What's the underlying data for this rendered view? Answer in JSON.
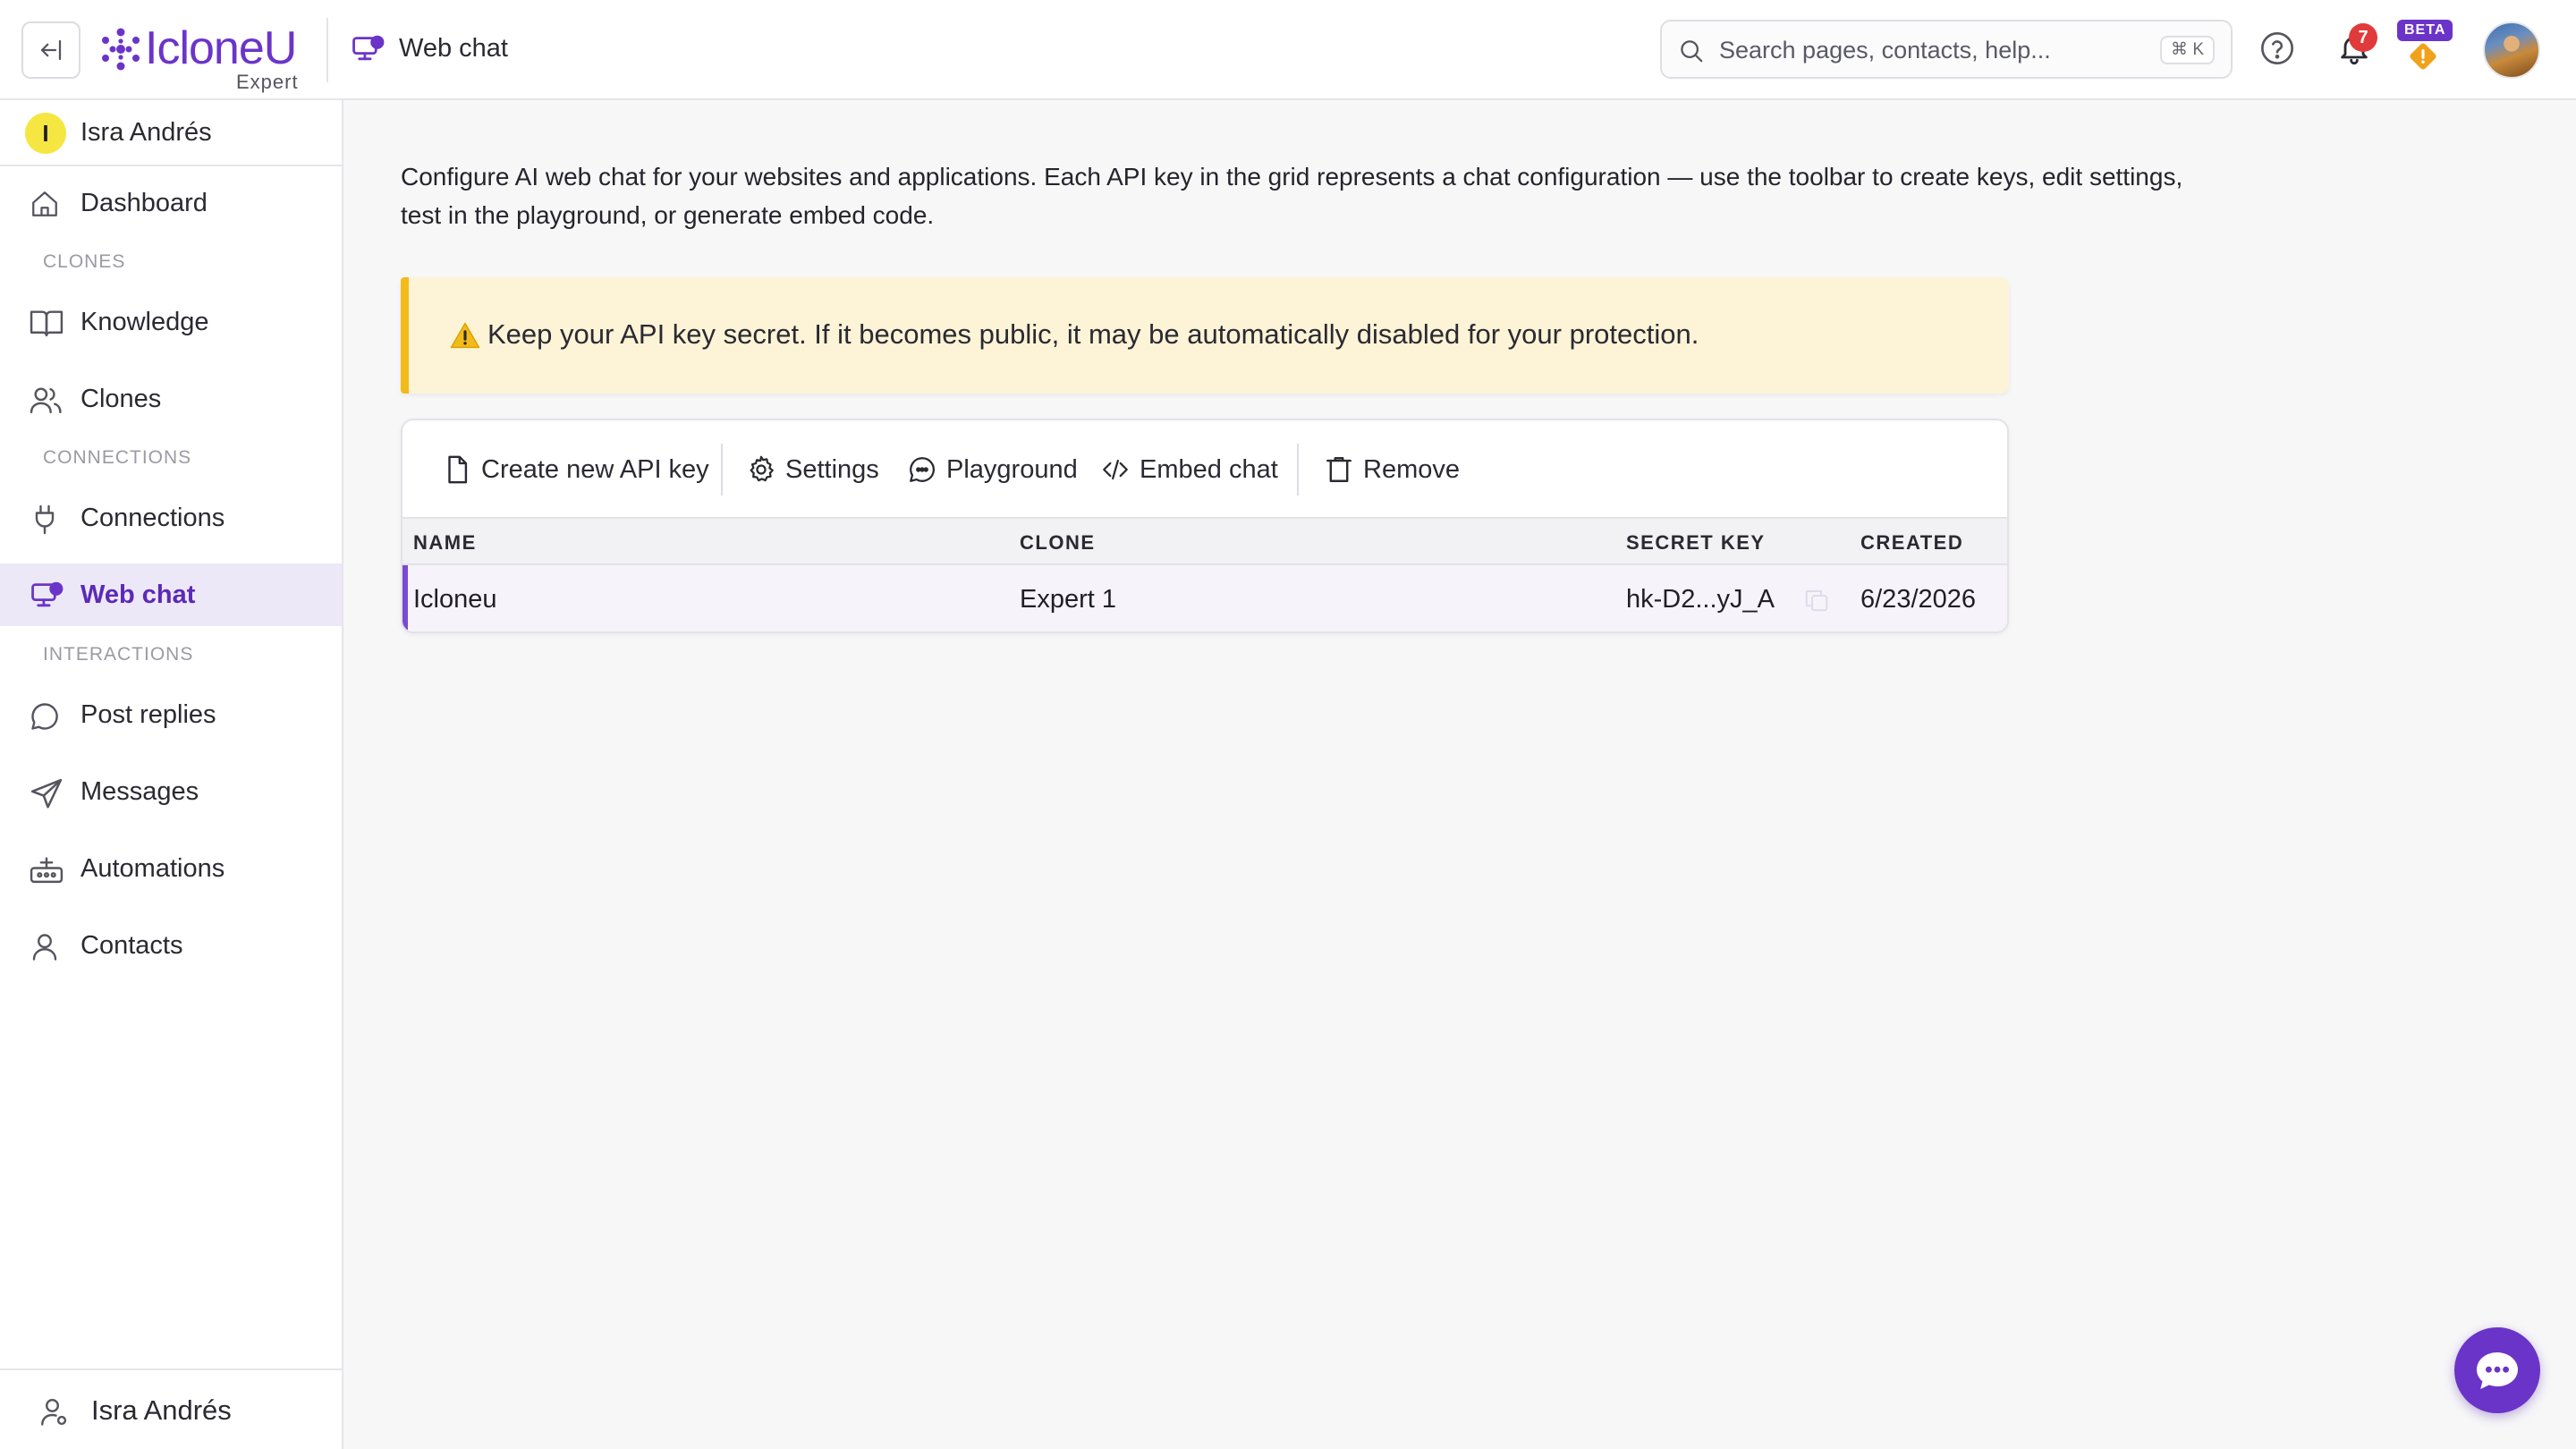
{
  "app": {
    "brand_name": "IcloneU",
    "brand_sub": "Expert",
    "page_title": "Web chat",
    "accent": "#6b34c9"
  },
  "header": {
    "search_placeholder": "Search pages, contacts, help...",
    "search_shortcut": "⌘ K",
    "notifications_count": "7",
    "beta_label": "BETA"
  },
  "sidebar": {
    "workspace_initial": "I",
    "workspace_name": "Isra Andrés",
    "items": [
      {
        "label": "Dashboard",
        "icon": "home-icon"
      },
      {
        "label": "Knowledge",
        "icon": "book-icon"
      },
      {
        "label": "Clones",
        "icon": "users-icon"
      },
      {
        "label": "Connections",
        "icon": "plug-icon"
      },
      {
        "label": "Web chat",
        "icon": "monitor-chat-icon",
        "active": true
      },
      {
        "label": "Post replies",
        "icon": "chat-bubble-icon"
      },
      {
        "label": "Messages",
        "icon": "send-icon"
      },
      {
        "label": "Automations",
        "icon": "automation-icon"
      },
      {
        "label": "Contacts",
        "icon": "user-icon"
      }
    ],
    "sections": {
      "clones": "CLONES",
      "connections": "CONNECTIONS",
      "interactions": "INTERACTIONS"
    },
    "footer_user": "Isra Andrés"
  },
  "main": {
    "intro_text": "Configure AI web chat for your websites and applications. Each API key in the grid represents a chat configuration — use the toolbar to create keys, edit settings, test in the playground, or generate embed code.",
    "alert_text": "Keep your API key secret. If it becomes public, it may be automatically disabled for your protection.",
    "toolbar": {
      "create": "Create new API key",
      "settings": "Settings",
      "playground": "Playground",
      "embed": "Embed chat",
      "remove": "Remove"
    },
    "table": {
      "columns": [
        "NAME",
        "CLONE",
        "SECRET KEY",
        "CREATED"
      ],
      "rows": [
        {
          "name": "Icloneu",
          "clone": "Expert 1",
          "secret_key": "hk-D2...yJ_A",
          "created": "6/23/2026"
        }
      ]
    }
  }
}
